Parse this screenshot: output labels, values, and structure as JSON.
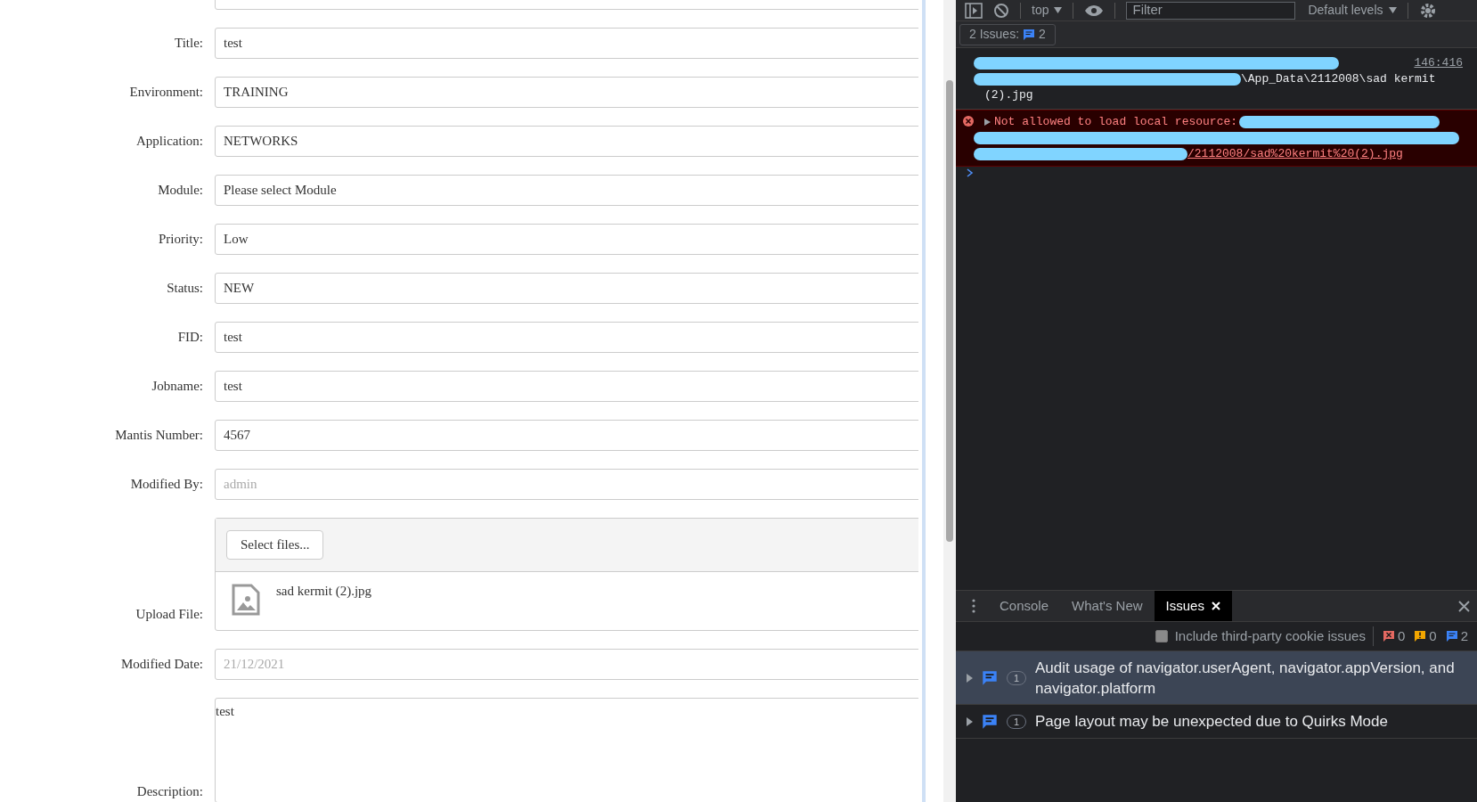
{
  "form": {
    "rows": [
      {
        "kind": "input",
        "label": "Title:",
        "value": "test",
        "disabled": false
      },
      {
        "kind": "input",
        "label": "Environment:",
        "value": "TRAINING",
        "disabled": false
      },
      {
        "kind": "input",
        "label": "Application:",
        "value": "NETWORKS",
        "disabled": false
      },
      {
        "kind": "input",
        "label": "Module:",
        "value": "Please select Module",
        "disabled": false
      },
      {
        "kind": "input",
        "label": "Priority:",
        "value": "Low",
        "disabled": false
      },
      {
        "kind": "input",
        "label": "Status:",
        "value": "NEW",
        "disabled": false
      },
      {
        "kind": "input",
        "label": "FID:",
        "value": "test",
        "disabled": false
      },
      {
        "kind": "input",
        "label": "Jobname:",
        "value": "test",
        "disabled": false
      },
      {
        "kind": "input",
        "label": "Mantis Number:",
        "value": "4567",
        "disabled": false
      },
      {
        "kind": "input",
        "label": "Modified By:",
        "value": "admin",
        "disabled": true
      },
      {
        "kind": "upload",
        "label": "Upload File:",
        "button": "Select files...",
        "file_name": "sad kermit (2).jpg"
      },
      {
        "kind": "input",
        "label": "Modified Date:",
        "value": "21/12/2021",
        "disabled": true
      },
      {
        "kind": "textarea",
        "label": "Description:",
        "value": "test"
      }
    ]
  },
  "devtools": {
    "toolbar": {
      "context": "top",
      "filter_placeholder": "Filter",
      "levels": "Default levels"
    },
    "issues_button": {
      "label": "2 Issues:",
      "count": "2"
    },
    "console_messages": [
      {
        "kind": "log",
        "lines": [
          "\\App_Data\\2112008\\sad kermit",
          "(2).jpg"
        ],
        "source": "146:416"
      },
      {
        "kind": "error",
        "text": "Not allowed to load local resource:",
        "link": "/2112008/sad%20kermit%20(2).jpg"
      }
    ],
    "drawer_tabs": [
      {
        "label": "Console",
        "selected": false
      },
      {
        "label": "What's New",
        "selected": false
      },
      {
        "label": "Issues",
        "selected": true
      }
    ],
    "third_party_checkbox": {
      "label": "Include third-party cookie issues",
      "checked": false
    },
    "counts": {
      "errors": "0",
      "warnings": "0",
      "info": "2"
    },
    "issues": [
      {
        "text": "Audit usage of navigator.userAgent, navigator.appVersion, and navigator.platform",
        "count": "1",
        "selected": true
      },
      {
        "text": "Page layout may be unexpected due to Quirks Mode",
        "count": "1",
        "selected": false
      }
    ]
  }
}
